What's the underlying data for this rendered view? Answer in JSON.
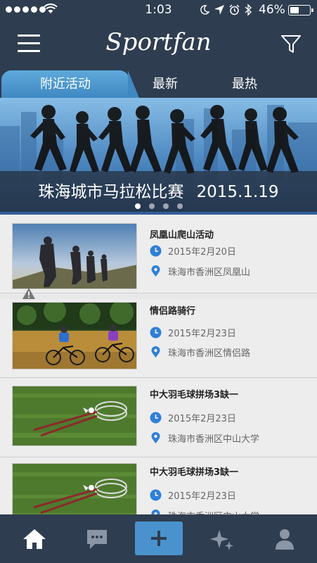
{
  "status_bar": {
    "time": "1:03",
    "battery_percent": "46%",
    "battery_level": 0.46
  },
  "nav": {
    "title": "Sportfan"
  },
  "tabs": [
    {
      "label": "附近活动",
      "active": true
    },
    {
      "label": "最新",
      "active": false
    },
    {
      "label": "最热",
      "active": false
    }
  ],
  "banner": {
    "title": "珠海城市马拉松比赛",
    "date": "2015.1.19",
    "page_count": 4,
    "current_page": 1
  },
  "activities": [
    {
      "title": "凤凰山爬山活动",
      "date": "2015年2月20日",
      "location": "珠海市香洲区凤凰山",
      "image": "hiking-photo"
    },
    {
      "title": "情侣路骑行",
      "date": "2015年2月23日",
      "location": "珠海市香洲区情侣路",
      "image": "cycling-photo"
    },
    {
      "title": "中大羽毛球拼场3缺一",
      "date": "2015年2月23日",
      "location": "珠海市香洲区中山大学",
      "image": "badminton-photo"
    },
    {
      "title": "中大羽毛球拼场3缺一",
      "date": "2015年2月23日",
      "location": "珠海市香洲区中山大学",
      "image": "badminton-photo"
    }
  ],
  "tab_bar": {
    "items": [
      "home-icon",
      "message-icon",
      "add-icon",
      "discover-icon",
      "profile-icon"
    ],
    "active": "home-icon",
    "accent": "#4a92ce"
  },
  "colors": {
    "nav_bg": "#2e3d50",
    "accent": "#3f88c2",
    "icon_blue": "#2f7fd8"
  }
}
